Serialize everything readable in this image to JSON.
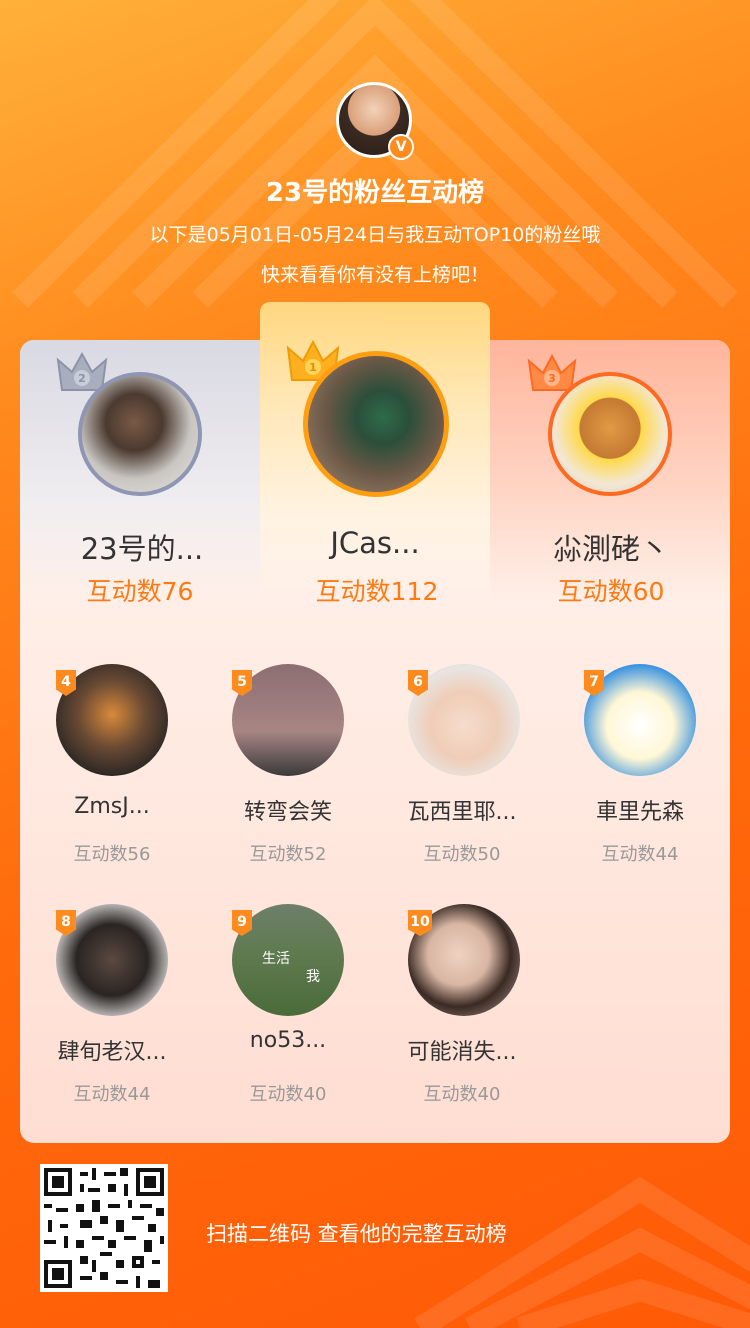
{
  "header": {
    "title": "23号的粉丝互动榜",
    "subtitle_line1": "以下是05月01日-05月24日与我互动TOP10的粉丝哦",
    "subtitle_line2": "快来看看你有没有上榜吧！",
    "verified_badge": "V"
  },
  "top3": [
    {
      "rank": "2",
      "name": "23号的...",
      "count": "互动数76"
    },
    {
      "rank": "1",
      "name": "JCas...",
      "count": "互动数112"
    },
    {
      "rank": "3",
      "name": "尛測硓丶",
      "count": "互动数60"
    }
  ],
  "fans": [
    {
      "rank": "4",
      "name": "ZmsJ...",
      "count": "互动数56"
    },
    {
      "rank": "5",
      "name": "转弯会笑",
      "count": "互动数52"
    },
    {
      "rank": "6",
      "name": "瓦西里耶...",
      "count": "互动数50"
    },
    {
      "rank": "7",
      "name": "車里先森",
      "count": "互动数44"
    },
    {
      "rank": "8",
      "name": "肆旬老汉...",
      "count": "互动数44"
    },
    {
      "rank": "9",
      "name": "no53...",
      "count": "互动数40"
    },
    {
      "rank": "10",
      "name": "可能消失...",
      "count": "互动数40"
    }
  ],
  "avatar_captions": {
    "fan9_a": "生活",
    "fan9_b": "我"
  },
  "footer": {
    "scan_text": "扫描二维码 查看他的完整互动榜"
  },
  "colors": {
    "accent": "#ff7a12",
    "tag": "#ff8a1d",
    "silver": "#9aa0b4",
    "gold": "#ffb020",
    "bronze": "#ff7a3a"
  }
}
